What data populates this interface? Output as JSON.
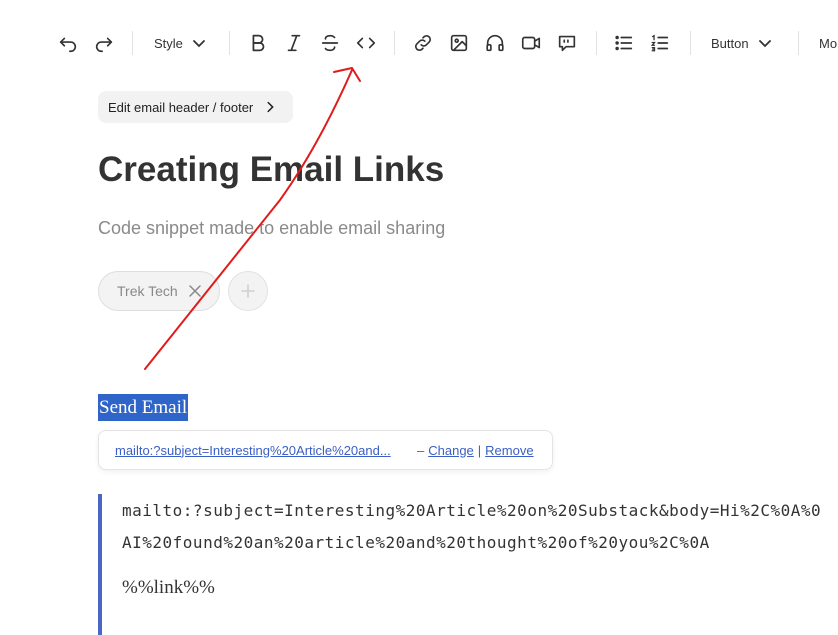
{
  "toolbar": {
    "style_label": "Style",
    "button_label": "Button",
    "more_label": "Mo",
    "icons": [
      "undo-icon",
      "redo-icon",
      "bold-icon",
      "italic-icon",
      "strikethrough-icon",
      "code-icon",
      "link-icon",
      "image-icon",
      "audio-icon",
      "video-icon",
      "comment-icon",
      "bullet-list-icon",
      "numbered-list-icon"
    ]
  },
  "header_footer": {
    "label": "Edit email header / footer"
  },
  "post": {
    "title": "Creating Email Links",
    "subtitle": "Code snippet made to enable email sharing"
  },
  "tags": [
    {
      "label": "Trek Tech"
    }
  ],
  "selection": {
    "text": "Send Email"
  },
  "link_popup": {
    "url": "mailto:?subject=Interesting%20Article%20and...",
    "dash": "–",
    "change_label": "Change",
    "separator": "|",
    "remove_label": "Remove"
  },
  "blockquote": {
    "code_text": "mailto:?subject=Interesting%20Article%20on%20Substack&body=Hi%2C%0A%0AI%20found%20an%20article%20and%20thought%20of%20you%2C%0A",
    "line2": "%%link%%"
  },
  "annotation": {
    "arrow_color": "#e01b1b"
  },
  "colors": {
    "selection": "#2f64c8",
    "link": "#3b5fc4",
    "quote_border": "#4b67c4"
  }
}
